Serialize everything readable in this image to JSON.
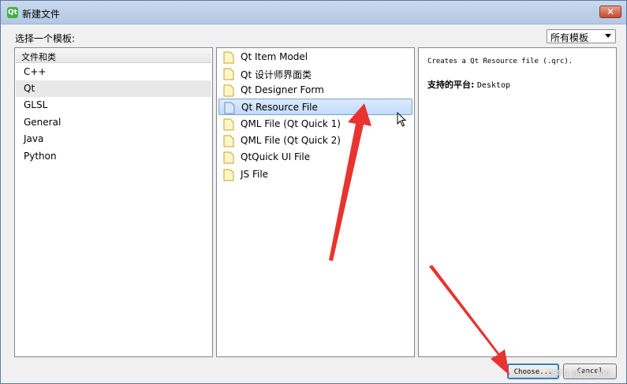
{
  "window": {
    "title": "新建文件",
    "app_icon": "qt-logo-icon",
    "close_glyph": "✕"
  },
  "choose_template_label": "选择一个模板:",
  "filter": {
    "selected": "所有模板"
  },
  "categories": {
    "header": "文件和类",
    "items": [
      "C++",
      "Qt",
      "GLSL",
      "General",
      "Java",
      "Python"
    ],
    "selected_index": 1
  },
  "templates": {
    "items": [
      "Qt Item Model",
      "Qt 设计师界面类",
      "Qt Designer Form",
      "Qt Resource File",
      "QML File (Qt Quick 1)",
      "QML File (Qt Quick 2)",
      "QtQuick UI File",
      "JS File"
    ],
    "selected_index": 3
  },
  "description": {
    "text": "Creates a Qt Resource file (.qrc).",
    "platform_label": "支持的平台:",
    "platform_value": "Desktop"
  },
  "buttons": {
    "choose": "Choose...",
    "cancel": "Cancel"
  },
  "watermark": "CSDN @Liu_166",
  "colors": {
    "annotation_arrow": "#e8332e",
    "selection": "#c1dbfc"
  }
}
